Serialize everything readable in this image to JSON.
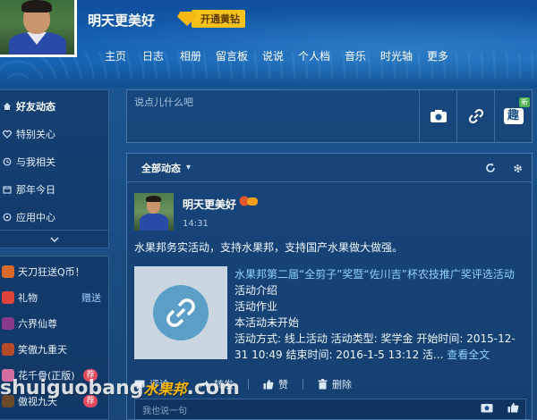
{
  "profile": {
    "username": "明天更美好",
    "vip_label": "开通黄钻"
  },
  "nav": [
    "主页",
    "日志",
    "相册",
    "留言板",
    "说说",
    "个人档",
    "音乐",
    "时光轴",
    "更多"
  ],
  "sidebar": {
    "items": [
      {
        "label": "好友动态",
        "icon": "home-icon",
        "active": true
      },
      {
        "label": "特别关心",
        "icon": "heart-icon"
      },
      {
        "label": "与我相关",
        "icon": "bell-icon"
      },
      {
        "label": "那年今日",
        "icon": "clock-icon"
      },
      {
        "label": "应用中心",
        "icon": "grid-icon"
      }
    ],
    "apps": [
      {
        "label": "天刀狂送Q币！",
        "icon": "game-icon",
        "color": "#d86a2a"
      },
      {
        "label": "礼物",
        "icon": "gift-icon",
        "color": "#e0433c",
        "tag": "赠送"
      },
      {
        "label": "六界仙尊",
        "icon": "game-icon",
        "color": "#8a3a8a"
      },
      {
        "label": "笑傲九重天",
        "icon": "game-icon",
        "color": "#b44a2a"
      },
      {
        "label": "花千骨(正版)",
        "icon": "game-icon",
        "color": "#d26fa0",
        "badge": "荐"
      },
      {
        "label": "傲视九天",
        "icon": "game-icon",
        "color": "#6a4a2a",
        "badge": "荐"
      }
    ]
  },
  "publisher": {
    "placeholder": "说点儿什么吧",
    "new_tag": "新",
    "fun_label": "趣"
  },
  "feed": {
    "filter_label": "全部动态",
    "post": {
      "author": "明天更美好",
      "time": "14:31",
      "text": "水果邦务实活动，支持水果邦，支持国产水果做大做强。",
      "link": {
        "title": "水果邦第二届“全剪子”奖暨“佐川吉”杯农技推广奖评选活动",
        "lines": [
          "活动介绍",
          "活动作业",
          "本活动未开始"
        ],
        "detail": "活动方式: 线上活动 活动类型: 奖学金 开始时间: 2015-12-31 10:49 结束时间: 2016-1-5 13:12 活...",
        "read_more": "查看全文"
      },
      "actions": {
        "comment": "评论",
        "forward": "转发",
        "like": "赞",
        "delete": "删除"
      },
      "comment_placeholder": "我也说一句"
    }
  },
  "watermark": {
    "latin": "shuiguobang",
    "cn": "水果邦",
    "tld": ".com"
  },
  "colors": {
    "accent_link": "#8fd0ff",
    "vip_gold": "#f7c21a",
    "badge_red": "#e84a5f"
  }
}
